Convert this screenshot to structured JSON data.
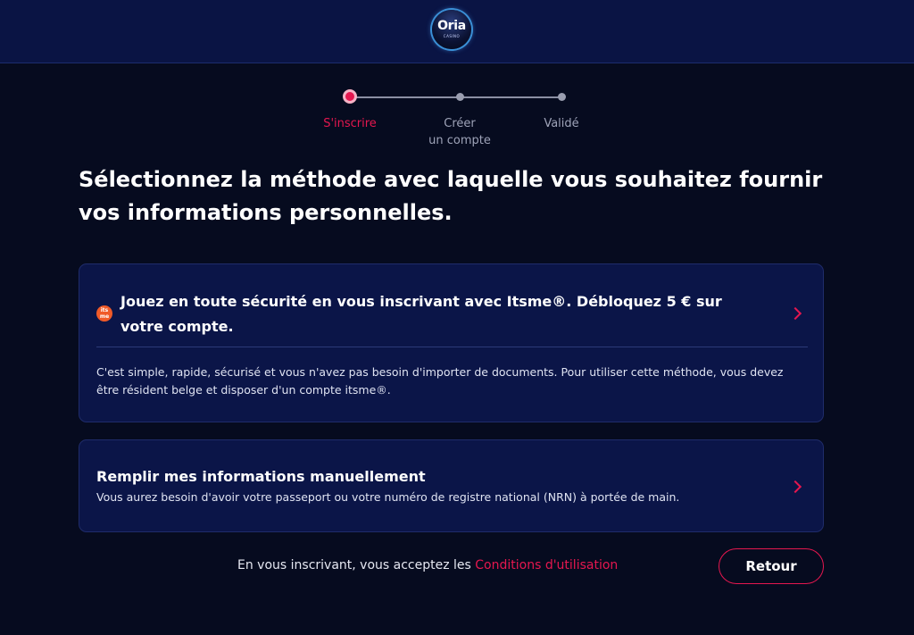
{
  "header": {
    "logo_text": "Oria",
    "logo_subtext": "CASINO"
  },
  "stepper": {
    "steps": [
      {
        "label": "S'inscrire",
        "state": "active"
      },
      {
        "label": "Créer un compte",
        "label_line1": "Créer",
        "label_line2": "un compte",
        "state": "upcoming"
      },
      {
        "label": "Validé",
        "state": "upcoming"
      }
    ]
  },
  "page_title": "Sélectionnez la méthode avec laquelle vous souhaitez fournir vos informations personnelles.",
  "options": {
    "itsme": {
      "icon_text_line1": "its",
      "icon_text_line2": "me",
      "title": "Jouez en toute sécurité en vous inscrivant avec Itsme®. Débloquez 5 € sur votre compte.",
      "description": "C'est simple, rapide, sécurisé et vous n'avez pas besoin d'importer de documents. Pour utiliser cette méthode, vous devez être résident belge et disposer d'un compte itsme®."
    },
    "manual": {
      "title": "Remplir mes informations manuellement",
      "description": "Vous aurez besoin d'avoir votre passeport ou votre numéro de registre national (NRN) à portée de main."
    }
  },
  "footer": {
    "terms_prefix": "En vous inscrivant, vous acceptez les ",
    "terms_link": "Conditions d'utilisation",
    "back_button": "Retour"
  },
  "colors": {
    "background": "#060b1f",
    "header": "#0a1444",
    "card": "#0b1548",
    "accent": "#e5174f",
    "itsme_orange": "#f05a28"
  },
  "icons": {
    "chevron": "chevron-right-icon",
    "itsme": "itsme-logo-icon"
  }
}
